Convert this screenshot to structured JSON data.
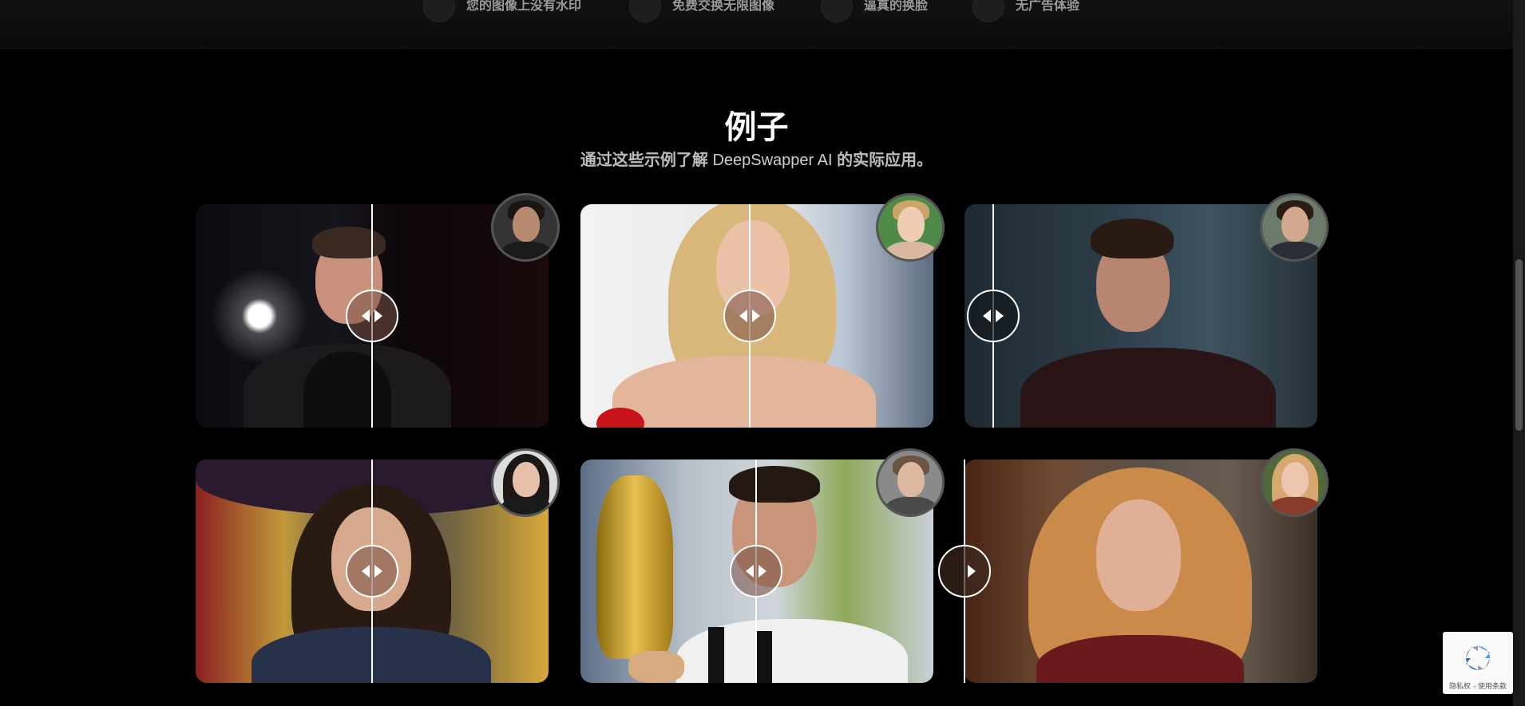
{
  "features": [
    {
      "label": "您的图像上没有水印",
      "icon": "watermark-icon"
    },
    {
      "label": "免费交换无限图像",
      "icon": "infinite-icon"
    },
    {
      "label": "逼真的换脸",
      "icon": "face-icon"
    },
    {
      "label": "无广告体验",
      "icon": "no-ads-icon"
    }
  ],
  "examples": {
    "title": "例子",
    "subtitle_pre": "通过这些示例了解",
    "subtitle_brand": "DeepSwapper AI",
    "subtitle_post": "的实际应用。"
  },
  "cards": [
    {
      "name": "card-1",
      "slider_percent": 50
    },
    {
      "name": "card-2",
      "slider_percent": 48
    },
    {
      "name": "card-3",
      "slider_percent": 8
    },
    {
      "name": "card-4",
      "slider_percent": 50
    },
    {
      "name": "card-5",
      "slider_percent": 50
    },
    {
      "name": "card-6",
      "slider_percent": 0
    }
  ],
  "recaptcha": {
    "text": "隐私权 - 使用条款"
  },
  "colors": {
    "background": "#000000",
    "accent": "#ffffff"
  }
}
